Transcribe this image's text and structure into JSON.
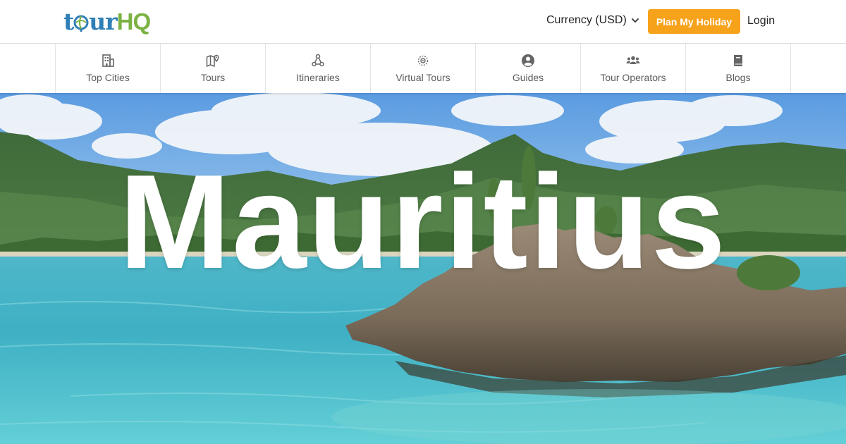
{
  "header": {
    "logo_part1": "tour",
    "logo_part2": "HQ",
    "currency_label": "Currency (USD)",
    "plan_button_label": "Plan My Holiday",
    "login_label": "Login"
  },
  "nav": {
    "items": [
      {
        "label": "Top Cities",
        "icon": "building-icon"
      },
      {
        "label": "Tours",
        "icon": "map-pin-icon"
      },
      {
        "label": "Itineraries",
        "icon": "itinerary-nodes-icon"
      },
      {
        "label": "Virtual Tours",
        "icon": "virtual-tour-icon"
      },
      {
        "label": "Guides",
        "icon": "user-circle-icon"
      },
      {
        "label": "Tour Operators",
        "icon": "users-group-icon"
      },
      {
        "label": "Blogs",
        "icon": "book-icon"
      }
    ]
  },
  "hero": {
    "title": "Mauritius"
  },
  "colors": {
    "accent_orange": "#f7a21b",
    "logo_blue": "#2f7fb6",
    "logo_green": "#7bb242"
  }
}
